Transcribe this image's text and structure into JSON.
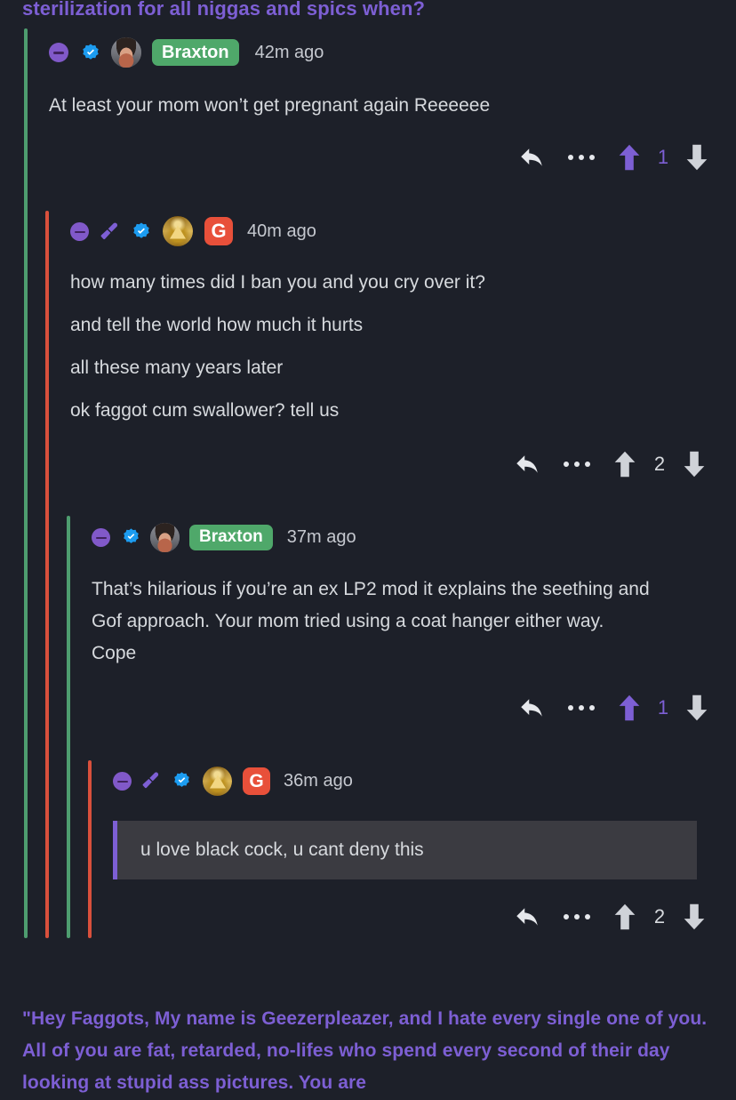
{
  "thread": {
    "title_truncated": "sterilization for all niggas and spics when?",
    "title_color": "#7d5fd4",
    "background_color": "#1d2029",
    "body_text_color": "#d7dade",
    "accent_purple": "#7d5fd4",
    "username_pill_color": "#4fa86a",
    "g_badge_color": "#e8503a",
    "line_green": "#4e9d6f",
    "line_red": "#d9503c"
  },
  "comments": [
    {
      "id": "comment-1",
      "depth": 1,
      "icons": [
        "collapse-icon",
        "verified-icon"
      ],
      "avatar": "photo-avatar",
      "username": "Braxton",
      "has_username_pill": true,
      "timestamp": "42m ago",
      "paragraphs": [
        "At least your mom won’t get pregnant again Reeeeee"
      ],
      "quote": null,
      "actions": {
        "reply_label": "reply",
        "more_label": "more",
        "upvote_label": "upvote",
        "downvote_label": "downvote",
        "vote_count": "1",
        "upvote_active": true
      }
    },
    {
      "id": "comment-2",
      "depth": 2,
      "icons": [
        "collapse-icon",
        "mic-icon",
        "verified-icon"
      ],
      "avatar": "masonic-avatar",
      "username": "",
      "has_username_pill": false,
      "badge": "G",
      "timestamp": "40m ago",
      "paragraphs": [
        "how many times did I ban you and you cry over it?",
        "and tell the world how much it hurts",
        "all these many years later",
        "ok faggot cum swallower? tell us"
      ],
      "quote": null,
      "actions": {
        "reply_label": "reply",
        "more_label": "more",
        "upvote_label": "upvote",
        "downvote_label": "downvote",
        "vote_count": "2",
        "upvote_active": false
      }
    },
    {
      "id": "comment-3",
      "depth": 3,
      "icons": [
        "collapse-icon",
        "verified-icon"
      ],
      "avatar": "photo-avatar",
      "username": "Braxton",
      "has_username_pill": true,
      "timestamp": "37m ago",
      "paragraphs": [
        "That’s hilarious if you’re an ex LP2 mod it explains the seething and Gof approach. Your mom tried using a coat hanger either way. Cope"
      ],
      "quote": null,
      "actions": {
        "reply_label": "reply",
        "more_label": "more",
        "upvote_label": "upvote",
        "downvote_label": "downvote",
        "vote_count": "1",
        "upvote_active": true
      }
    },
    {
      "id": "comment-4",
      "depth": 4,
      "icons": [
        "collapse-icon",
        "mic-icon",
        "verified-icon"
      ],
      "avatar": "masonic-avatar",
      "username": "",
      "has_username_pill": false,
      "badge": "G",
      "timestamp": "36m ago",
      "paragraphs": [],
      "quote": "u love black cock, u cant deny this",
      "actions": {
        "reply_label": "reply",
        "more_label": "more",
        "upvote_label": "upvote",
        "downvote_label": "downvote",
        "vote_count": "2",
        "upvote_active": false
      }
    }
  ],
  "footer": {
    "text": "\"Hey Faggots, My name is Geezerpleazer, and I hate every single one of you. All of you are fat, retarded, no-lifes who spend every second of their day looking at stupid ass pictures. You are"
  }
}
